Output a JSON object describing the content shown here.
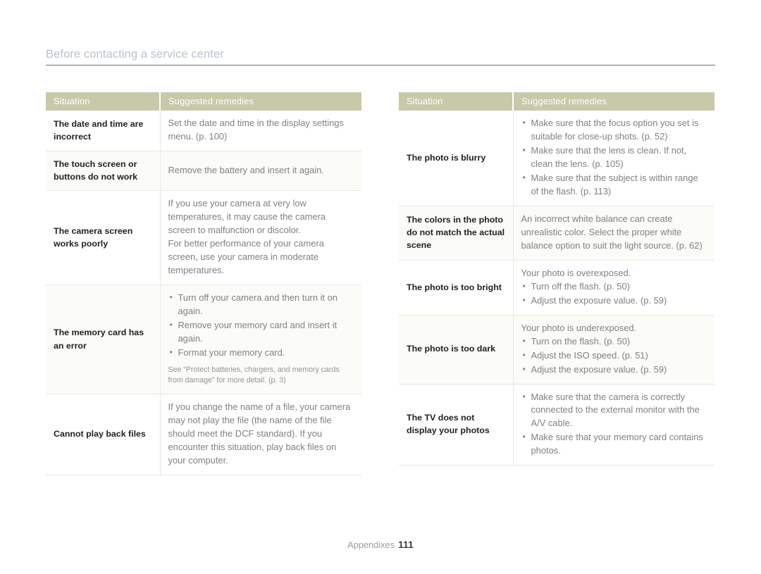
{
  "header": {
    "title": "Before contacting a service center"
  },
  "tables": {
    "left": {
      "columns": [
        "Situation",
        "Suggested remedies"
      ],
      "rows": [
        {
          "situation": "The date and time are incorrect",
          "paragraphs": [
            "Set the date and time in the display settings menu. (p. 100)"
          ],
          "bullets": [],
          "note": ""
        },
        {
          "situation": "The touch screen or buttons do not work",
          "paragraphs": [
            "Remove the battery and insert it again."
          ],
          "bullets": [],
          "note": ""
        },
        {
          "situation": "The camera screen works poorly",
          "paragraphs": [
            "If you use your camera at very low temperatures, it may cause the camera screen to malfunction or discolor.",
            "For better performance of your camera screen, use your camera in moderate temperatures."
          ],
          "bullets": [],
          "note": ""
        },
        {
          "situation": "The memory card has an error",
          "paragraphs": [],
          "bullets": [
            "Turn off your camera and then turn it on again.",
            "Remove your memory card and insert it again.",
            "Format your memory card."
          ],
          "note": "See “Protect batteries, chargers, and memory cards from damage” for more detail. (p. 3)"
        },
        {
          "situation": "Cannot play back files",
          "paragraphs": [
            "If you change the name of a file, your camera may not play the file (the name of the file should meet the DCF standard). If you encounter this situation, play back files on your computer."
          ],
          "bullets": [],
          "note": ""
        }
      ]
    },
    "right": {
      "columns": [
        "Situation",
        "Suggested remedies"
      ],
      "rows": [
        {
          "situation": "The photo is blurry",
          "paragraphs": [],
          "bullets": [
            "Make sure that the focus option you set is suitable for close-up shots. (p. 52)",
            "Make sure that the lens is clean. If not, clean the lens. (p. 105)",
            "Make sure that the subject is within range of the flash. (p. 113)"
          ],
          "note": ""
        },
        {
          "situation": "The colors in the photo do not match the actual scene",
          "paragraphs": [
            "An incorrect white balance can create unrealistic color. Select the proper white balance option to suit the light source. (p. 62)"
          ],
          "bullets": [],
          "note": ""
        },
        {
          "situation": "The photo is too bright",
          "paragraphs": [
            "Your photo is overexposed."
          ],
          "bullets": [
            "Turn off the flash. (p. 50)",
            "Adjust the exposure value. (p. 59)"
          ],
          "note": ""
        },
        {
          "situation": "The photo is too dark",
          "paragraphs": [
            "Your photo is underexposed."
          ],
          "bullets": [
            "Turn on the flash. (p. 50)",
            "Adjust the ISO speed. (p. 51)",
            "Adjust the exposure value. (p. 59)"
          ],
          "note": ""
        },
        {
          "situation": "The TV does not display your photos",
          "paragraphs": [],
          "bullets": [
            "Make sure that the camera is correctly connected to the external monitor with the A/V cable.",
            "Make sure that your memory card contains photos."
          ],
          "note": ""
        }
      ]
    }
  },
  "footer": {
    "label": "Appendixes",
    "page_number": "111"
  },
  "colors": {
    "header_band": "#c7c9a8",
    "title_text": "#b9c4cb",
    "body_text": "#808184",
    "situation_text": "#231f20",
    "row_alt_background": "#fbfbf8",
    "rule": "#6d6e71"
  }
}
